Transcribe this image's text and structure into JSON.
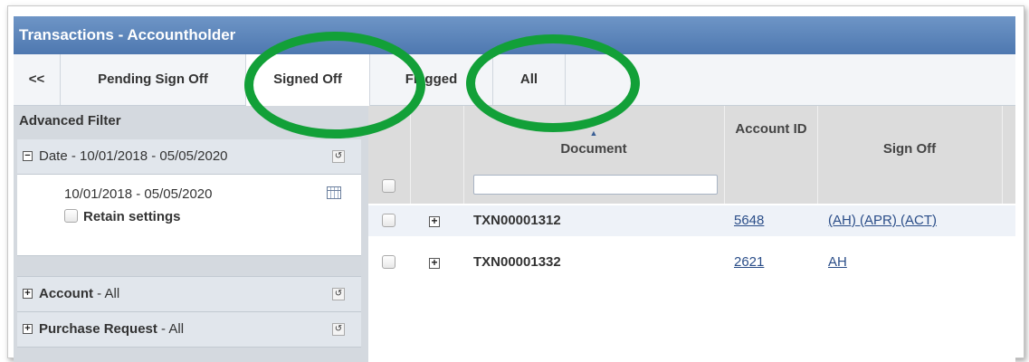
{
  "window": {
    "title": "Transactions - Accountholder"
  },
  "tabs": {
    "back": "<<",
    "items": [
      {
        "label": "Pending Sign Off"
      },
      {
        "label": "Signed Off"
      },
      {
        "label": "Flagged"
      },
      {
        "label": "All"
      }
    ],
    "active": "Signed Off"
  },
  "filter": {
    "title": "Advanced Filter",
    "date": {
      "label": "Date",
      "value": "10/01/2018 - 05/05/2020",
      "range": "10/01/2018 - 05/05/2020",
      "retain_label": "Retain settings"
    },
    "account": {
      "label": "Account",
      "value": "All"
    },
    "purchase_request": {
      "label": "Purchase Request",
      "value": "All"
    },
    "sep": " - "
  },
  "grid": {
    "columns": {
      "document": "Document",
      "account_id": "Account ID",
      "sign_off": "Sign Off"
    },
    "sort_indicator": "▲",
    "rows": [
      {
        "document": "TXN00001312",
        "account_id": "5648",
        "sign_off": "(AH) (APR) (ACT)"
      },
      {
        "document": "TXN00001332",
        "account_id": "2621",
        "sign_off": "AH"
      }
    ]
  },
  "colors": {
    "accent_header": "#5b84bb",
    "highlight_circle": "#12a038"
  },
  "icons": [
    "expand-icon",
    "collapse-icon",
    "reset-icon",
    "calendar-icon",
    "sort-asc-icon"
  ]
}
